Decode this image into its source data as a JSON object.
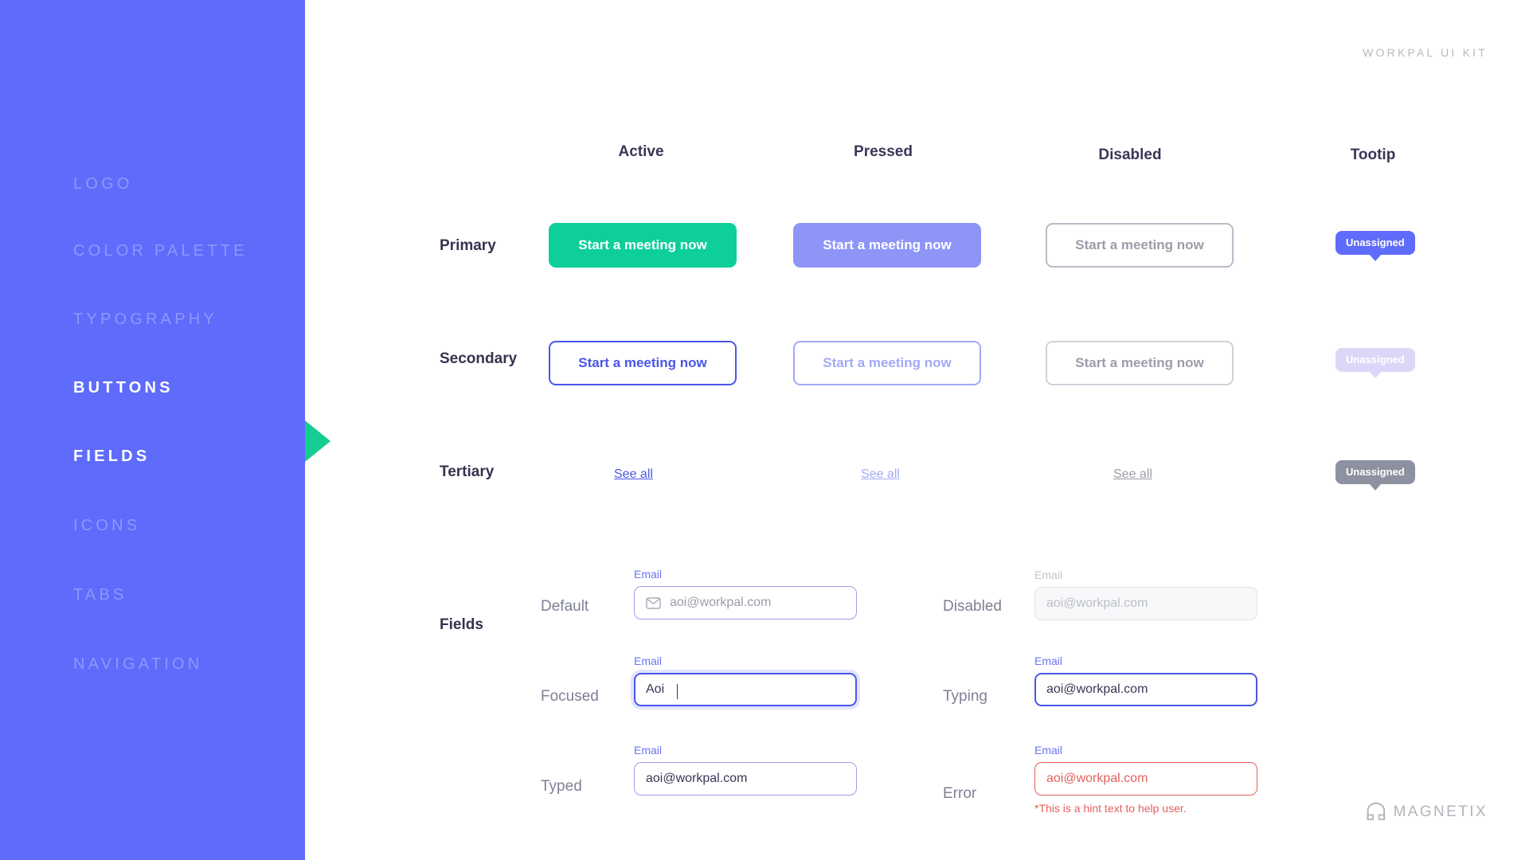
{
  "header": {
    "kit_title": "WORKPAL UI KIT"
  },
  "brand": {
    "name": "MAGNETIX",
    "icon": "magnet-icon"
  },
  "sidebar": {
    "background_color": "#5f6bfb",
    "marker_color": "#15cc93",
    "items": [
      {
        "label": "LOGO",
        "active": false
      },
      {
        "label": "COLOR PALETTE",
        "active": false
      },
      {
        "label": "TYPOGRAPHY",
        "active": false
      },
      {
        "label": "BUTTONS",
        "active": true
      },
      {
        "label": "FIELDS",
        "active": true
      },
      {
        "label": "ICONS",
        "active": false
      },
      {
        "label": "TABS",
        "active": false
      },
      {
        "label": "NAVIGATION",
        "active": false
      }
    ]
  },
  "buttons_section": {
    "column_headers": [
      "Active",
      "Pressed",
      "Disabled",
      "Tootip"
    ],
    "row_labels": [
      "Primary",
      "Secondary",
      "Tertiary"
    ],
    "primary": {
      "active_label": "Start a meeting now",
      "pressed_label": "Start a meeting now",
      "disabled_label": "Start a meeting now",
      "tooltip_label": "Unassigned",
      "active_color": "#0ecf9a",
      "pressed_color": "#8e95f7",
      "disabled_border": "#b9bcc8",
      "tooltip_color": "#5f6bfb"
    },
    "secondary": {
      "active_label": "Start a meeting now",
      "pressed_label": "Start a meeting now",
      "disabled_label": "Start a meeting now",
      "tooltip_label": "Unassigned",
      "active_color": "#4b56e8",
      "pressed_color": "#a3a9f7",
      "disabled_border": "#cfd2da",
      "tooltip_color": "#dcd7f8"
    },
    "tertiary": {
      "active_label": "See all",
      "pressed_label": "See all",
      "disabled_label": "See all",
      "tooltip_label": "Unassigned",
      "active_color": "#4b56e8",
      "pressed_color": "#a3a9f7",
      "disabled_color": "#9b9dab",
      "tooltip_color": "#8e919f"
    }
  },
  "fields_section": {
    "group_label": "Fields",
    "states": {
      "default": {
        "state_label": "Default",
        "field_label": "Email",
        "value": "aoi@workpal.com",
        "icon": "envelope-icon",
        "border_color": "#9aa0ea"
      },
      "focused": {
        "state_label": "Focused",
        "field_label": "Email",
        "value": "Aoi",
        "border_color": "#4b56e8"
      },
      "typed": {
        "state_label": "Typed",
        "field_label": "Email",
        "value": "aoi@workpal.com",
        "border_color": "#9aa0ea"
      },
      "disabled": {
        "state_label": "Disabled",
        "field_label": "Email",
        "value": "aoi@workpal.com",
        "border_color": "#e1e3e9"
      },
      "typing": {
        "state_label": "Typing",
        "field_label": "Email",
        "value": "aoi@workpal.com",
        "border_color": "#4b56e8"
      },
      "error": {
        "state_label": "Error",
        "field_label": "Email",
        "value": "aoi@workpal.com",
        "hint": "*This is a hint text to help user.",
        "border_color": "#e2615e"
      }
    }
  }
}
